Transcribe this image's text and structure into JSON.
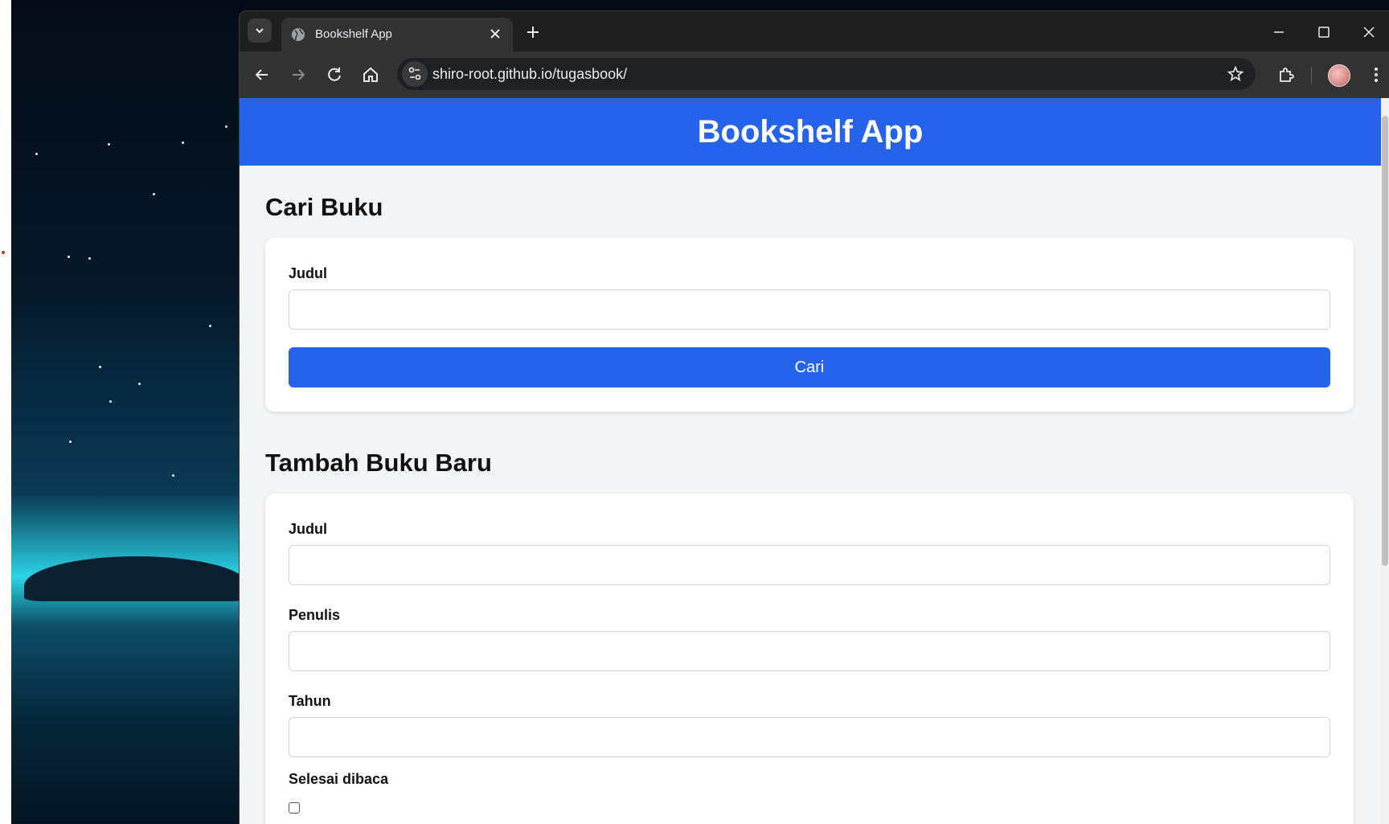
{
  "browser": {
    "tab_title": "Bookshelf App",
    "url": "shiro-root.github.io/tugasbook/"
  },
  "page": {
    "app_title": "Bookshelf App",
    "search": {
      "heading": "Cari Buku",
      "title_label": "Judul",
      "title_value": "",
      "button_label": "Cari"
    },
    "add_book": {
      "heading": "Tambah Buku Baru",
      "title_label": "Judul",
      "title_value": "",
      "author_label": "Penulis",
      "author_value": "",
      "year_label": "Tahun",
      "year_value": "",
      "finished_label": "Selesai dibaca",
      "finished_checked": false
    }
  },
  "colors": {
    "accent": "#2563eb",
    "page_bg": "#f3f4f6"
  }
}
